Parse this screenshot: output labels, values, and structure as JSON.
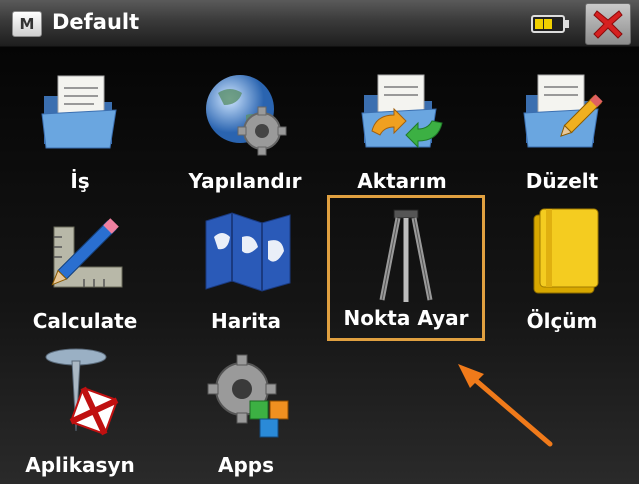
{
  "window": {
    "badge": "M",
    "title": "Default",
    "battery_icon": "battery-icon",
    "close_icon": "close-icon"
  },
  "tiles": [
    {
      "label": "İş",
      "icon": "folder-document-icon"
    },
    {
      "label": "Yapılandır",
      "icon": "globe-gear-icon"
    },
    {
      "label": "Aktarım",
      "icon": "folder-sync-icon"
    },
    {
      "label": "Düzelt",
      "icon": "folder-pencil-icon"
    },
    {
      "label": "Calculate",
      "icon": "ruler-pencil-icon"
    },
    {
      "label": "Harita",
      "icon": "map-icon"
    },
    {
      "label": "Nokta Ayar",
      "icon": "tripod-icon"
    },
    {
      "label": "Ölçüm",
      "icon": "notebook-icon"
    },
    {
      "label": "Aplikasyn",
      "icon": "stakeout-pin-icon"
    },
    {
      "label": "Apps",
      "icon": "apps-gear-icon"
    }
  ],
  "colors": {
    "selection_border": "#e0a040",
    "annotation_arrow": "#f07a1a",
    "close_red": "#d62020"
  }
}
